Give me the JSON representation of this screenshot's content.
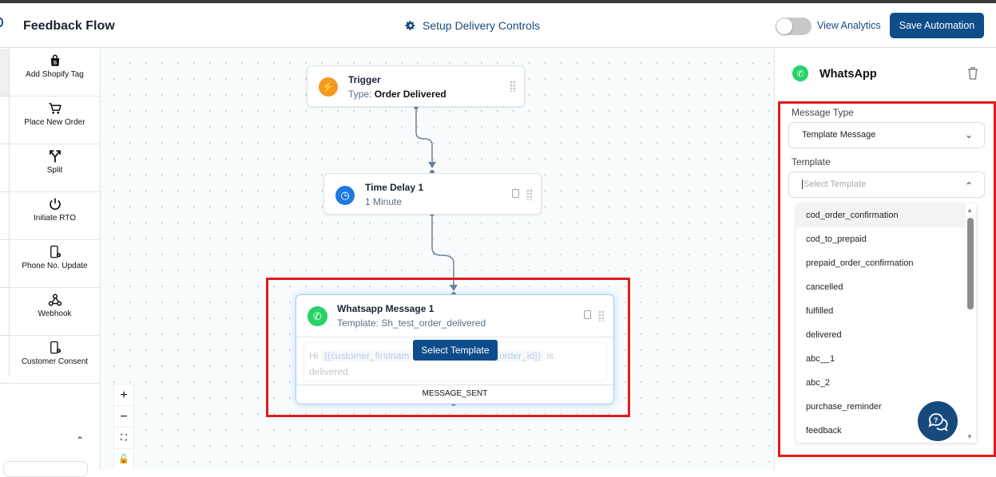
{
  "header": {
    "title": "Feedback Flow",
    "setup_label": "Setup Delivery Controls",
    "analytics_label": "View Analytics",
    "analytics_toggle_on": false,
    "save_label": "Save Automation"
  },
  "sidebar": {
    "items": [
      {
        "label": "Add Shopify Tag",
        "icon": "shopify-bag-icon"
      },
      {
        "label": "Place New Order",
        "icon": "cart-icon"
      },
      {
        "label": "Split",
        "icon": "split-icon"
      },
      {
        "label": "Initiate RTO",
        "icon": "power-icon"
      },
      {
        "label": "Phone No. Update",
        "icon": "phone-gear-icon"
      },
      {
        "label": "Webhook",
        "icon": "webhook-icon"
      },
      {
        "label": "Customer Consent",
        "icon": "phone-gear-icon"
      }
    ]
  },
  "canvas": {
    "trigger": {
      "title": "Trigger",
      "type_label": "Type:",
      "type_value": "Order Delivered"
    },
    "delay": {
      "title": "Time Delay 1",
      "value": "1 Minute"
    },
    "whatsapp": {
      "title": "Whatsapp Message 1",
      "template": "Template: Sh_test_order_delivered",
      "msg_hi": "Hi",
      "var1": "{{customer_firstnam",
      "var2": "{{order_id}}",
      "msg_is": "is",
      "msg_end": "delivered.",
      "select_label": "Select Template",
      "footer": "MESSAGE_SENT"
    },
    "zoom": {
      "in": "+",
      "out": "−"
    }
  },
  "panel": {
    "title": "WhatsApp",
    "message_type_label": "Message Type",
    "message_type_value": "Template Message",
    "template_label": "Template",
    "template_placeholder": "Select Template",
    "options": [
      "cod_order_confirmation",
      "cod_to_prepaid",
      "prepaid_order_confirmation",
      "cancelled",
      "fulfilled",
      "delivered",
      "abc__1",
      "abc_2",
      "purchase_reminder",
      "feedback"
    ]
  },
  "colors": {
    "brand": "#0f4c8a",
    "highlight": "#e21b1b",
    "whatsapp": "#25d366",
    "trigger": "#f29a1f",
    "delay": "#1f7ae0"
  }
}
